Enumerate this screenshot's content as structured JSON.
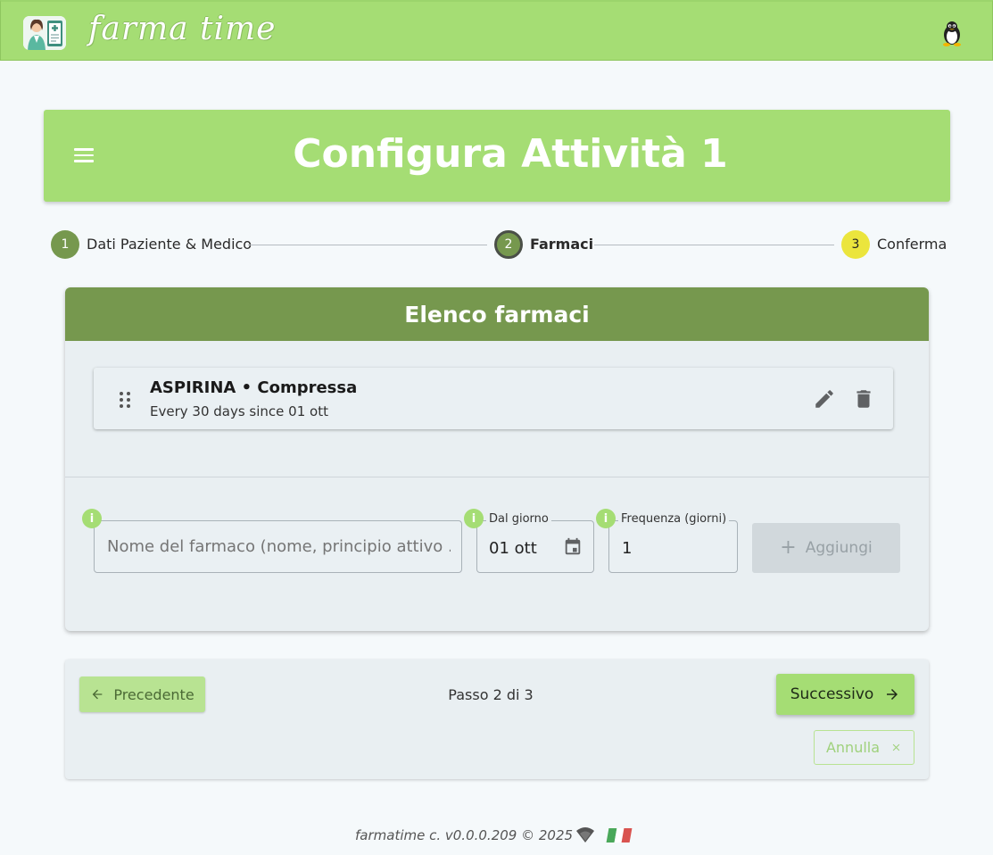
{
  "app": {
    "brand": "farma time"
  },
  "header": {
    "title": "Configura Attività 1"
  },
  "stepper": {
    "steps": [
      {
        "number": "1",
        "label": "Dati Paziente & Medico",
        "state": "completed"
      },
      {
        "number": "2",
        "label": "Farmaci",
        "state": "active"
      },
      {
        "number": "3",
        "label": "Conferma",
        "state": "pending"
      }
    ]
  },
  "drugs_card": {
    "title": "Elenco farmaci",
    "items": [
      {
        "name": "ASPIRINA • Compressa",
        "schedule": "Every 30 days since 01 ott"
      }
    ]
  },
  "add_form": {
    "drug_name_placeholder": "Nome del farmaco (nome, principio attivo ...",
    "from_day_label": "Dal giorno",
    "from_day_value": "01 ott",
    "frequency_label": "Frequenza (giorni)",
    "frequency_value": "1",
    "info_glyph": "i",
    "add_label": "Aggiungi"
  },
  "navigation": {
    "prev_label": "Precedente",
    "step_counter": "Passo 2 di 3",
    "next_label": "Successivo",
    "cancel_label": "Annulla"
  },
  "footer": {
    "text": "farmatime c. v0.0.0.209 © 2025"
  },
  "colors": {
    "primary": "#a5dd74",
    "dark_green": "#76984e",
    "pending_step": "#ebe53d",
    "flag": [
      "#4aa85a",
      "#ffffff",
      "#d9534f"
    ]
  }
}
